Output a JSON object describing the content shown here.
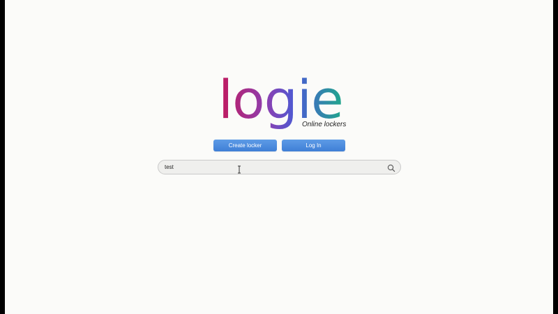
{
  "logo": {
    "wordmark": "logie",
    "tagline": "Online lockers",
    "gradient_colors": [
      "#c2185b",
      "#8e3fb0",
      "#4a5bd4",
      "#1fa88a"
    ]
  },
  "actions": {
    "create_label": "Create locker",
    "login_label": "Log In",
    "button_color": "#4a8ae0"
  },
  "search": {
    "value": "test",
    "icon": "search-icon"
  },
  "pointer": {
    "icon": "i-beam-cursor-icon"
  }
}
